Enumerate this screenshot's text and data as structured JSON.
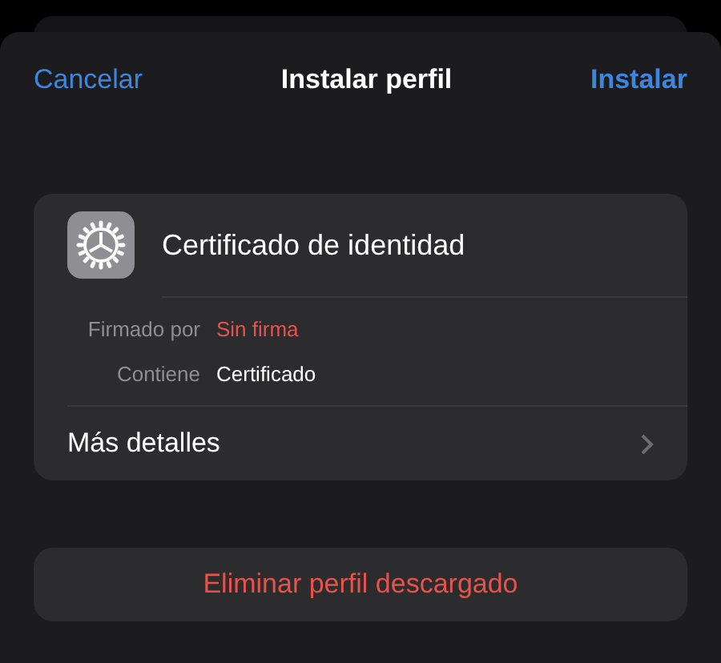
{
  "nav": {
    "cancel": "Cancelar",
    "title": "Instalar perfil",
    "install": "Instalar"
  },
  "profile": {
    "name": "Certificado de identidad",
    "details": [
      {
        "label": "Firmado por",
        "value": "Sin firma",
        "kind": "warning"
      },
      {
        "label": "Contiene",
        "value": "Certificado",
        "kind": "plain"
      }
    ],
    "more": "Más detalles"
  },
  "delete_button": "Eliminar perfil descargado"
}
